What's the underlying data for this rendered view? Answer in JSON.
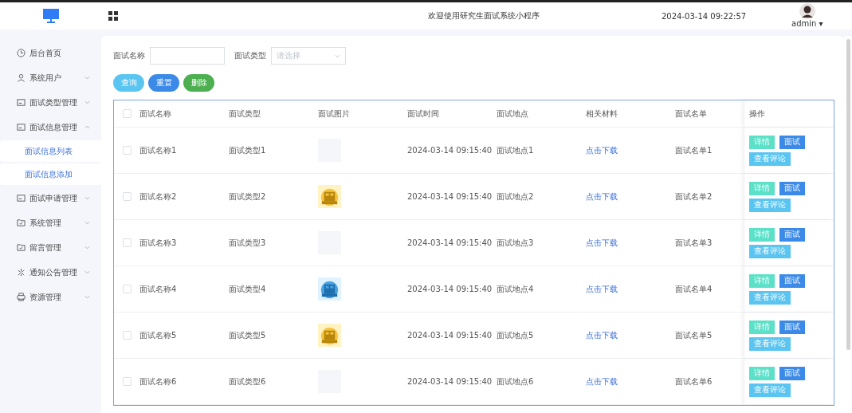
{
  "header": {
    "title": "欢迎使用研究生面试系统小程序",
    "datetime": "2024-03-14 09:22:57",
    "user": "admin ▾"
  },
  "sidebar": {
    "items": [
      {
        "label": "后台首页"
      },
      {
        "label": "系统用户",
        "expanded": false
      },
      {
        "label": "面试类型管理",
        "expanded": false
      },
      {
        "label": "面试信息管理",
        "expanded": true,
        "children": [
          {
            "label": "面试信息列表"
          },
          {
            "label": "面试信息添加"
          }
        ]
      },
      {
        "label": "面试申请管理",
        "expanded": false
      },
      {
        "label": "系统管理",
        "expanded": false
      },
      {
        "label": "留言管理",
        "expanded": false
      },
      {
        "label": "通知公告管理",
        "expanded": false
      },
      {
        "label": "资源管理",
        "expanded": false
      }
    ]
  },
  "search": {
    "fields": [
      {
        "label": "面试名称",
        "kind": "text"
      },
      {
        "label": "面试类型",
        "kind": "select",
        "placeholder": "请选择"
      }
    ],
    "buttons": [
      {
        "label": "查询",
        "color": "#5bc5f2"
      },
      {
        "label": "重置",
        "color": "#3c8ae8"
      },
      {
        "label": "删除",
        "color": "#4caf50"
      }
    ]
  },
  "table": {
    "all_checked": false,
    "columns": [
      "面试名称",
      "面试类型",
      "面试图片",
      "面试时间",
      "面试地点",
      "相关材料",
      "面试名单",
      "操作"
    ],
    "rows": [
      {
        "checked": false,
        "name": "面试名称1",
        "type": "面试类型1",
        "image": {
          "kind": "placeholder"
        },
        "time": "2024-03-14 09:15:40",
        "place": "面试地点1",
        "material": "点击下载",
        "list": "面试名单1",
        "actions": [
          "详情",
          "面试",
          "查看评论"
        ]
      },
      {
        "checked": false,
        "name": "面试名称2",
        "type": "面试类型2",
        "time": "2024-03-14 09:15:40",
        "place": "面试地点2",
        "material": "点击下载",
        "list": "面试名单2",
        "actions": [
          "详情",
          "面试",
          "查看评论"
        ]
      },
      {
        "checked": false,
        "name": "面试名称3",
        "type": "面试类型3",
        "image": {
          "kind": "placeholder"
        },
        "time": "2024-03-14 09:15:40",
        "place": "面试地点3",
        "material": "点击下载",
        "list": "面试名单3",
        "actions": [
          "详情",
          "面试",
          "查看评论"
        ]
      },
      {
        "checked": false,
        "name": "面试名称4",
        "type": "面试类型4",
        "time": "2024-03-14 09:15:40",
        "place": "面试地点4",
        "material": "点击下载",
        "list": "面试名单4",
        "actions": [
          "详情",
          "面试",
          "查看评论"
        ]
      },
      {
        "checked": false,
        "name": "面试名称5",
        "type": "面试类型5",
        "time": "2024-03-14 09:15:40",
        "place": "面试地点5",
        "material": "点击下载",
        "list": "面试名单5",
        "actions": [
          "详情",
          "面试",
          "查看评论"
        ]
      },
      {
        "checked": false,
        "name": "面试名称6",
        "type": "面试类型6",
        "image": {
          "kind": "placeholder"
        },
        "time": "2024-03-14 09:15:40",
        "place": "面试地点6",
        "material": "点击下载",
        "list": "面试名单6",
        "actions": [
          "详情",
          "面试",
          "查看评论"
        ]
      }
    ]
  }
}
